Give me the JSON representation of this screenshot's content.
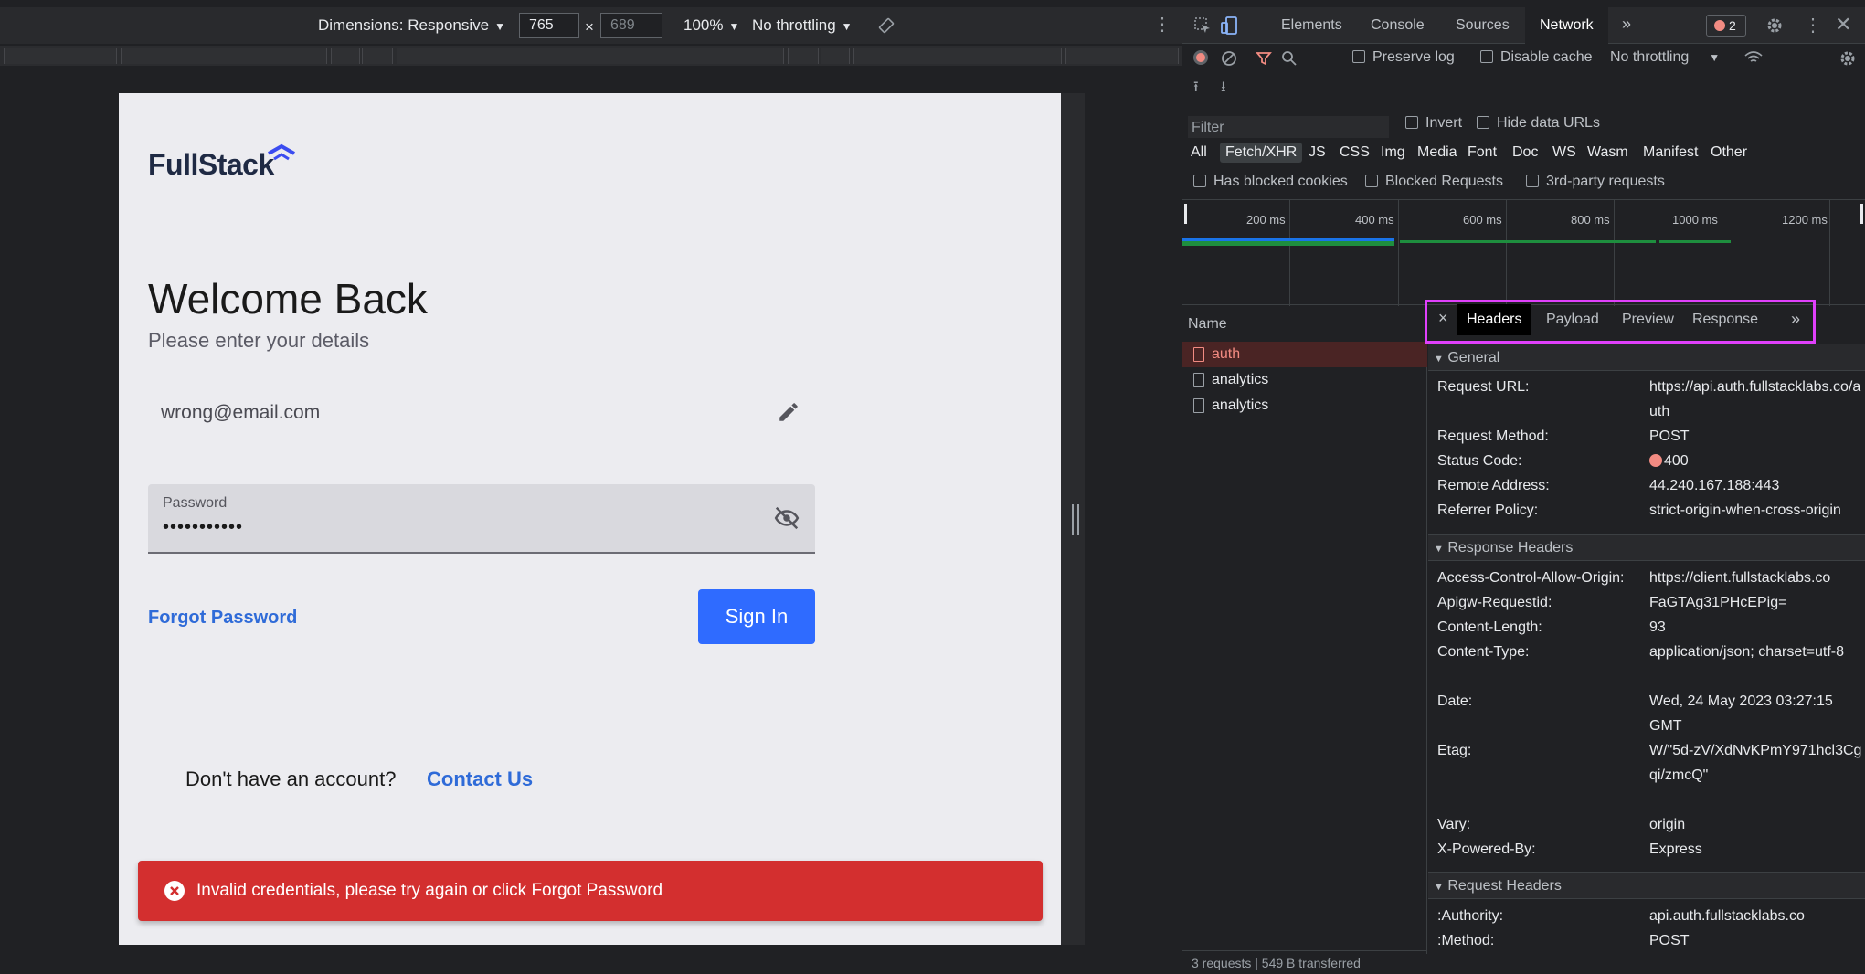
{
  "device_toolbar": {
    "dimensions": "Dimensions: Responsive",
    "width": "765",
    "height": "689",
    "times": "×",
    "zoom": "100%",
    "throttling": "No throttling"
  },
  "login": {
    "logo": "FullStack",
    "title": "Welcome Back",
    "subtitle": "Please enter your details",
    "email_value": "wrong@email.com",
    "password_label": "Password",
    "password_value": "•••••••••••",
    "forgot": "Forgot Password",
    "signin": "Sign In",
    "no_account": "Don't have an account?",
    "contact": "Contact Us",
    "error": "Invalid credentials, please try again or click Forgot Password"
  },
  "devtools": {
    "tabs": [
      "Elements",
      "Console",
      "Sources",
      "Network"
    ],
    "more": "»",
    "error_count": "2",
    "network_toolbar": {
      "preserve_log": "Preserve log",
      "disable_cache": "Disable cache",
      "throttling": "No throttling"
    },
    "filter": {
      "placeholder": "Filter",
      "invert": "Invert",
      "hide_data_urls": "Hide data URLs",
      "types": [
        "All",
        "Fetch/XHR",
        "JS",
        "CSS",
        "Img",
        "Media",
        "Font",
        "Doc",
        "WS",
        "Wasm",
        "Manifest",
        "Other"
      ],
      "has_blocked_cookies": "Has blocked cookies",
      "blocked_requests": "Blocked Requests",
      "third_party": "3rd-party requests"
    },
    "timeline_ticks": [
      "200 ms",
      "400 ms",
      "600 ms",
      "800 ms",
      "1000 ms",
      "1200 ms"
    ],
    "name_header": "Name",
    "requests": [
      "auth",
      "analytics",
      "analytics"
    ],
    "status_bar": "3 requests | 549 B transferred",
    "detail_tabs": [
      "Headers",
      "Payload",
      "Preview",
      "Response"
    ],
    "close": "×",
    "general": {
      "title": "General",
      "request_url_k": "Request URL:",
      "request_url_v": "https://api.auth.fullstacklabs.co/auth",
      "request_method_k": "Request Method:",
      "request_method_v": "POST",
      "status_code_k": "Status Code:",
      "status_code_v": "400",
      "remote_address_k": "Remote Address:",
      "remote_address_v": "44.240.167.188:443",
      "referrer_policy_k": "Referrer Policy:",
      "referrer_policy_v": "strict-origin-when-cross-origin"
    },
    "response_headers": {
      "title": "Response Headers",
      "acao_k": "Access-Control-Allow-Origin:",
      "acao_v": "https://client.fullstacklabs.co",
      "apigw_k": "Apigw-Requestid:",
      "apigw_v": "FaGTAg31PHcEPig=",
      "content_length_k": "Content-Length:",
      "content_length_v": "93",
      "content_type_k": "Content-Type:",
      "content_type_v": "application/json; charset=utf-8",
      "date_k": "Date:",
      "date_v": "Wed, 24 May 2023 03:27:15 GMT",
      "etag_k": "Etag:",
      "etag_v": "W/\"5d-zV/XdNvKPmY971hcl3Cgqi/zmcQ\"",
      "vary_k": "Vary:",
      "vary_v": "origin",
      "xpb_k": "X-Powered-By:",
      "xpb_v": "Express"
    },
    "request_headers": {
      "title": "Request Headers",
      "authority_k": ":Authority:",
      "authority_v": "api.auth.fullstacklabs.co",
      "method_k": ":Method:",
      "method_v": "POST"
    }
  },
  "colors": {
    "accent_blue": "#2f6bff",
    "error_red": "#d32f2f",
    "highlight_magenta": "#e040fb"
  }
}
